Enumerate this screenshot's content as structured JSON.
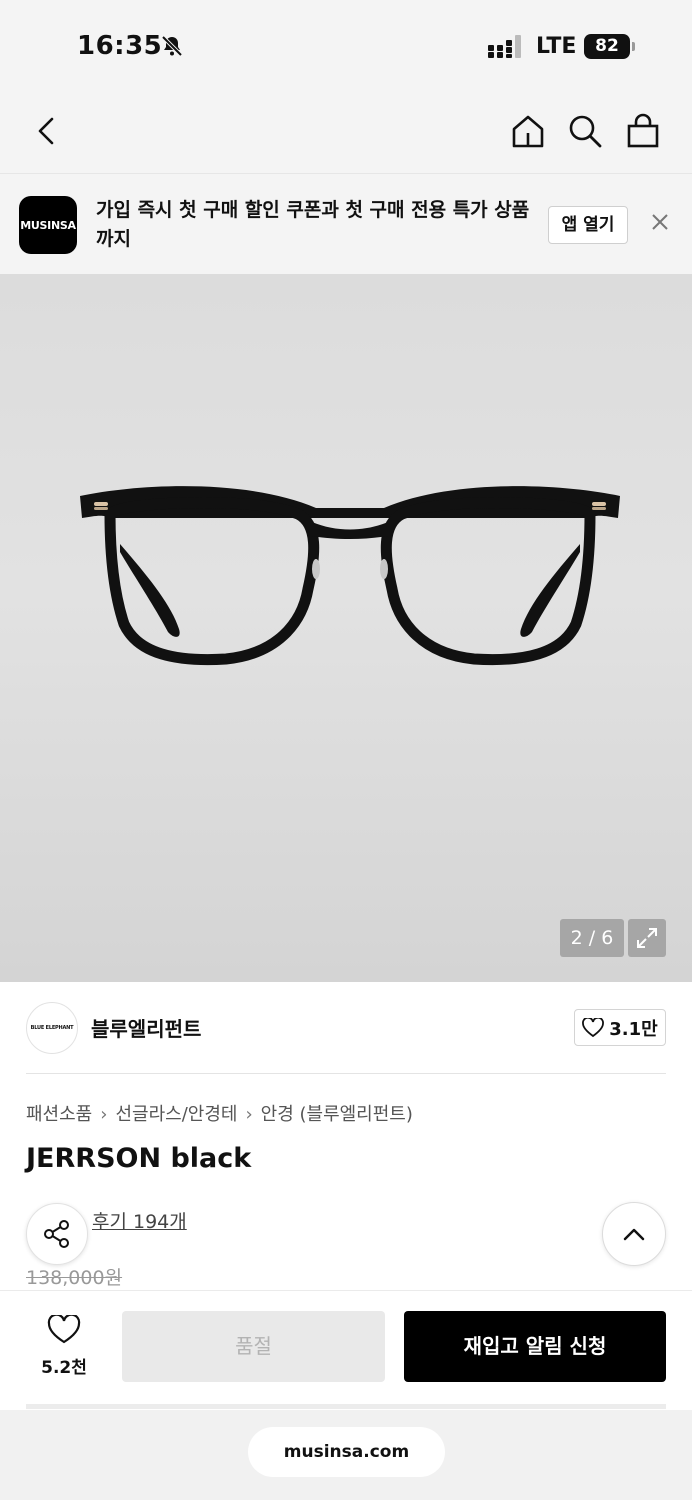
{
  "status_bar": {
    "time": "16:35",
    "network": "LTE",
    "battery": "82"
  },
  "nav": {
    "icons": [
      "back-icon",
      "home-icon",
      "search-icon",
      "shopping-bag-icon"
    ]
  },
  "app_banner": {
    "logo_text": "MUSINSA",
    "message": "가입 즉시 첫 구매 할인 쿠폰과 첫 구매 전용 특가 상품까지",
    "open_app_label": "앱 열기"
  },
  "gallery": {
    "counter": "2 / 6"
  },
  "brand": {
    "logo_text": "BLUE ELEPHANT",
    "name": "블루엘리펀트",
    "likes": "3.1만"
  },
  "breadcrumb": [
    "패션소품",
    "선글라스/안경테",
    "안경 (블루엘리펀트)"
  ],
  "product": {
    "title": "JERRSON black",
    "review_link": "후기 194개",
    "original_price": "138,000원"
  },
  "bottom_bar": {
    "wish_count": "5.2천",
    "soldout_label": "품절",
    "restock_label": "재입고 알림 신청"
  },
  "browser": {
    "url": "musinsa.com"
  },
  "colors": {
    "primary": "#000000",
    "banner_bg": "#f4f4f4",
    "disabled_bg": "#e9e9e9"
  }
}
